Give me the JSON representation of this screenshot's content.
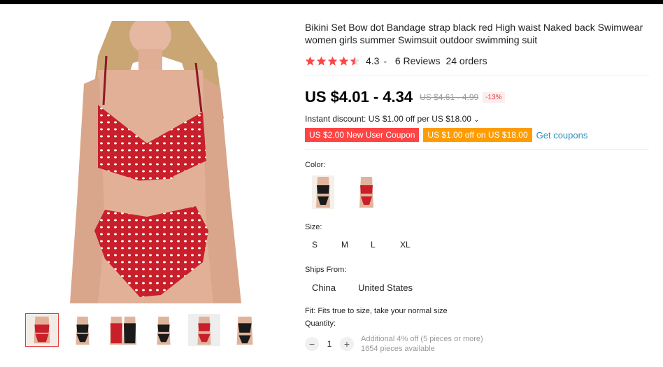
{
  "product": {
    "title": "Bikini Set Bow dot Bandage strap black red High waist Naked back Swimwear women girls summer Swimsuit outdoor swimming suit",
    "rating": "4.3",
    "reviews": "6 Reviews",
    "orders": "24 orders"
  },
  "price": {
    "current": "US $4.01 - 4.34",
    "original": "US $4.61 - 4.99",
    "discount": "-13%",
    "instant_discount": "Instant discount: US $1.00 off per US $18.00"
  },
  "coupons": {
    "new_user": "US $2.00 New User Coupon",
    "store": "US $1.00 off on US $18.00",
    "get_label": "Get coupons"
  },
  "options": {
    "color_label": "Color:",
    "size_label": "Size:",
    "sizes": [
      "S",
      "M",
      "L",
      "XL"
    ],
    "ships_label": "Ships From:",
    "ships": [
      "China",
      "United States"
    ],
    "fit": "Fit: Fits true to size, take your normal size"
  },
  "quantity": {
    "label": "Quantity:",
    "minus": "−",
    "value": "1",
    "plus": "+",
    "note_line1": "Additional 4% off (5 pieces or more)",
    "note_line2": "1654 pieces available"
  },
  "colors": {
    "star": "#f44",
    "red_suit": "#c81f2b",
    "black_suit": "#1a1a1a"
  }
}
